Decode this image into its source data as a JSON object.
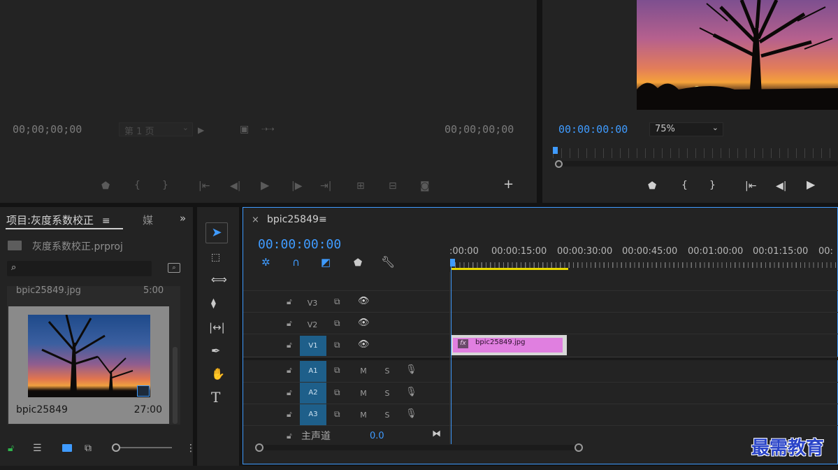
{
  "source_monitor": {
    "timecode_in": "00;00;00;00",
    "page_select": "第 1 页",
    "timecode_out": "00;00;00;00"
  },
  "program_monitor": {
    "timecode": "00:00:00:00",
    "zoom": "75%"
  },
  "project_panel": {
    "tab_label": "项目:灰度系数校正",
    "tab_menu": "≡",
    "media_tab": "媒",
    "file_name": "灰度系数校正.prproj",
    "search_placeholder": "",
    "item_top_name": "bpic25849.jpg",
    "item_top_duration": "5:00",
    "item_name": "bpic25849",
    "item_duration": "27:00"
  },
  "timeline": {
    "sequence_name": "bpic25849",
    "timecode": "00:00:00:00",
    "ruler": ":00:00",
    "ruler_labels": [
      ":00:00",
      "00:00:15:00",
      "00:00:30:00",
      "00:00:45:00",
      "00:01:00:00",
      "00:01:15:00",
      "00:"
    ],
    "video_tracks": [
      "V3",
      "V2",
      "V1"
    ],
    "audio_tracks": [
      "A1",
      "A2",
      "A3"
    ],
    "m_label": "M",
    "s_label": "S",
    "master_label": "主声道",
    "master_value": "0.0",
    "clip_name": "bpic25849.jpg",
    "clip_fx": "fx"
  },
  "watermark": "最需教育",
  "colors": {
    "accent_blue": "#3f9bff",
    "clip_pink": "#e07fe0",
    "track_tag_blue": "#1e5f8a",
    "work_area_yellow": "#e6d700"
  }
}
